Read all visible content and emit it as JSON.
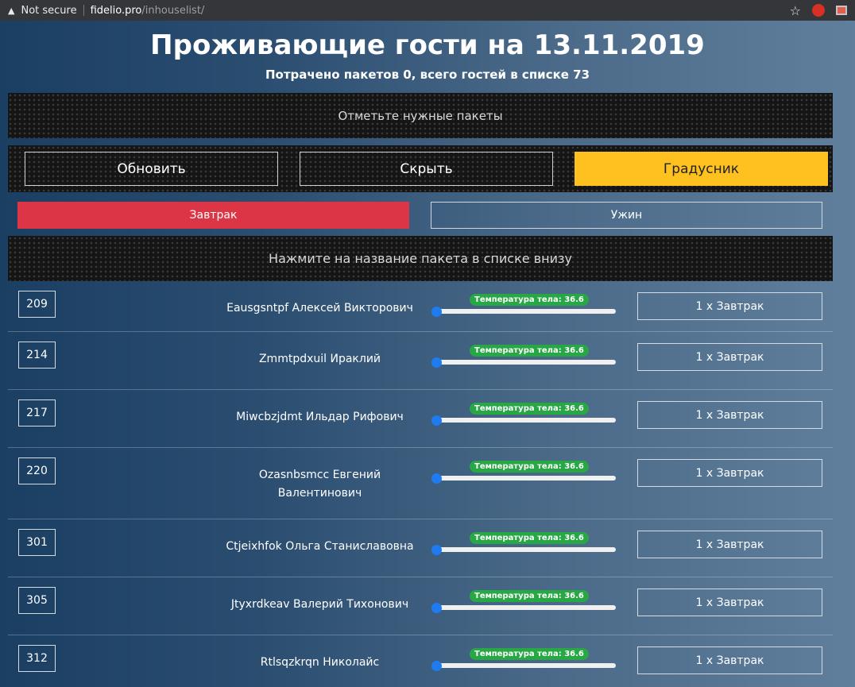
{
  "browser": {
    "security": "Not secure",
    "url_host": "fidelio.pro",
    "url_path": "/inhouselist/"
  },
  "header": {
    "title": "Проживающие гости на 13.11.2019",
    "subtitle": "Потрачено пакетов 0, всего гостей в списке 73"
  },
  "banner_top": "Отметьте нужные пакеты",
  "toolbar": {
    "refresh_label": "Обновить",
    "hide_label": "Скрыть",
    "thermometer_label": "Градусник"
  },
  "packages": {
    "breakfast_label": "Завтрак",
    "dinner_label": "Ужин"
  },
  "banner_bottom": "Нажмите на название пакета в списке внизу",
  "colors": {
    "accent_yellow": "#ffc120",
    "breakfast_red": "#dc3545",
    "badge_green": "#28a745",
    "slider_blue": "#1e7bf2"
  },
  "guests": [
    {
      "room": "209",
      "name": "Eausgsntpf Алексей Викторович",
      "temp_label": "Температура тела: 36.6",
      "meal": "1 x Завтрак"
    },
    {
      "room": "214",
      "name": "Zmmtpdxuil Ираклий",
      "temp_label": "Температура тела: 36.6",
      "meal": "1 x Завтрак"
    },
    {
      "room": "217",
      "name": "Miwcbzjdmt Ильдар Рифович",
      "temp_label": "Температура тела: 36.6",
      "meal": "1 x Завтрак"
    },
    {
      "room": "220",
      "name": "Ozasnbsmcc Евгений Валентинович",
      "temp_label": "Температура тела: 36.6",
      "meal": "1 x Завтрак"
    },
    {
      "room": "301",
      "name": "Ctjeixhfok Ольга Станиславовна",
      "temp_label": "Температура тела: 36.6",
      "meal": "1 x Завтрак"
    },
    {
      "room": "305",
      "name": "Jtyxrdkeav Валерий Тихонович",
      "temp_label": "Температура тела: 36.6",
      "meal": "1 x Завтрак"
    },
    {
      "room": "312",
      "name": "Rtlsqzkrqn Николайс",
      "temp_label": "Температура тела: 36.6",
      "meal": "1 x Завтрак"
    }
  ]
}
